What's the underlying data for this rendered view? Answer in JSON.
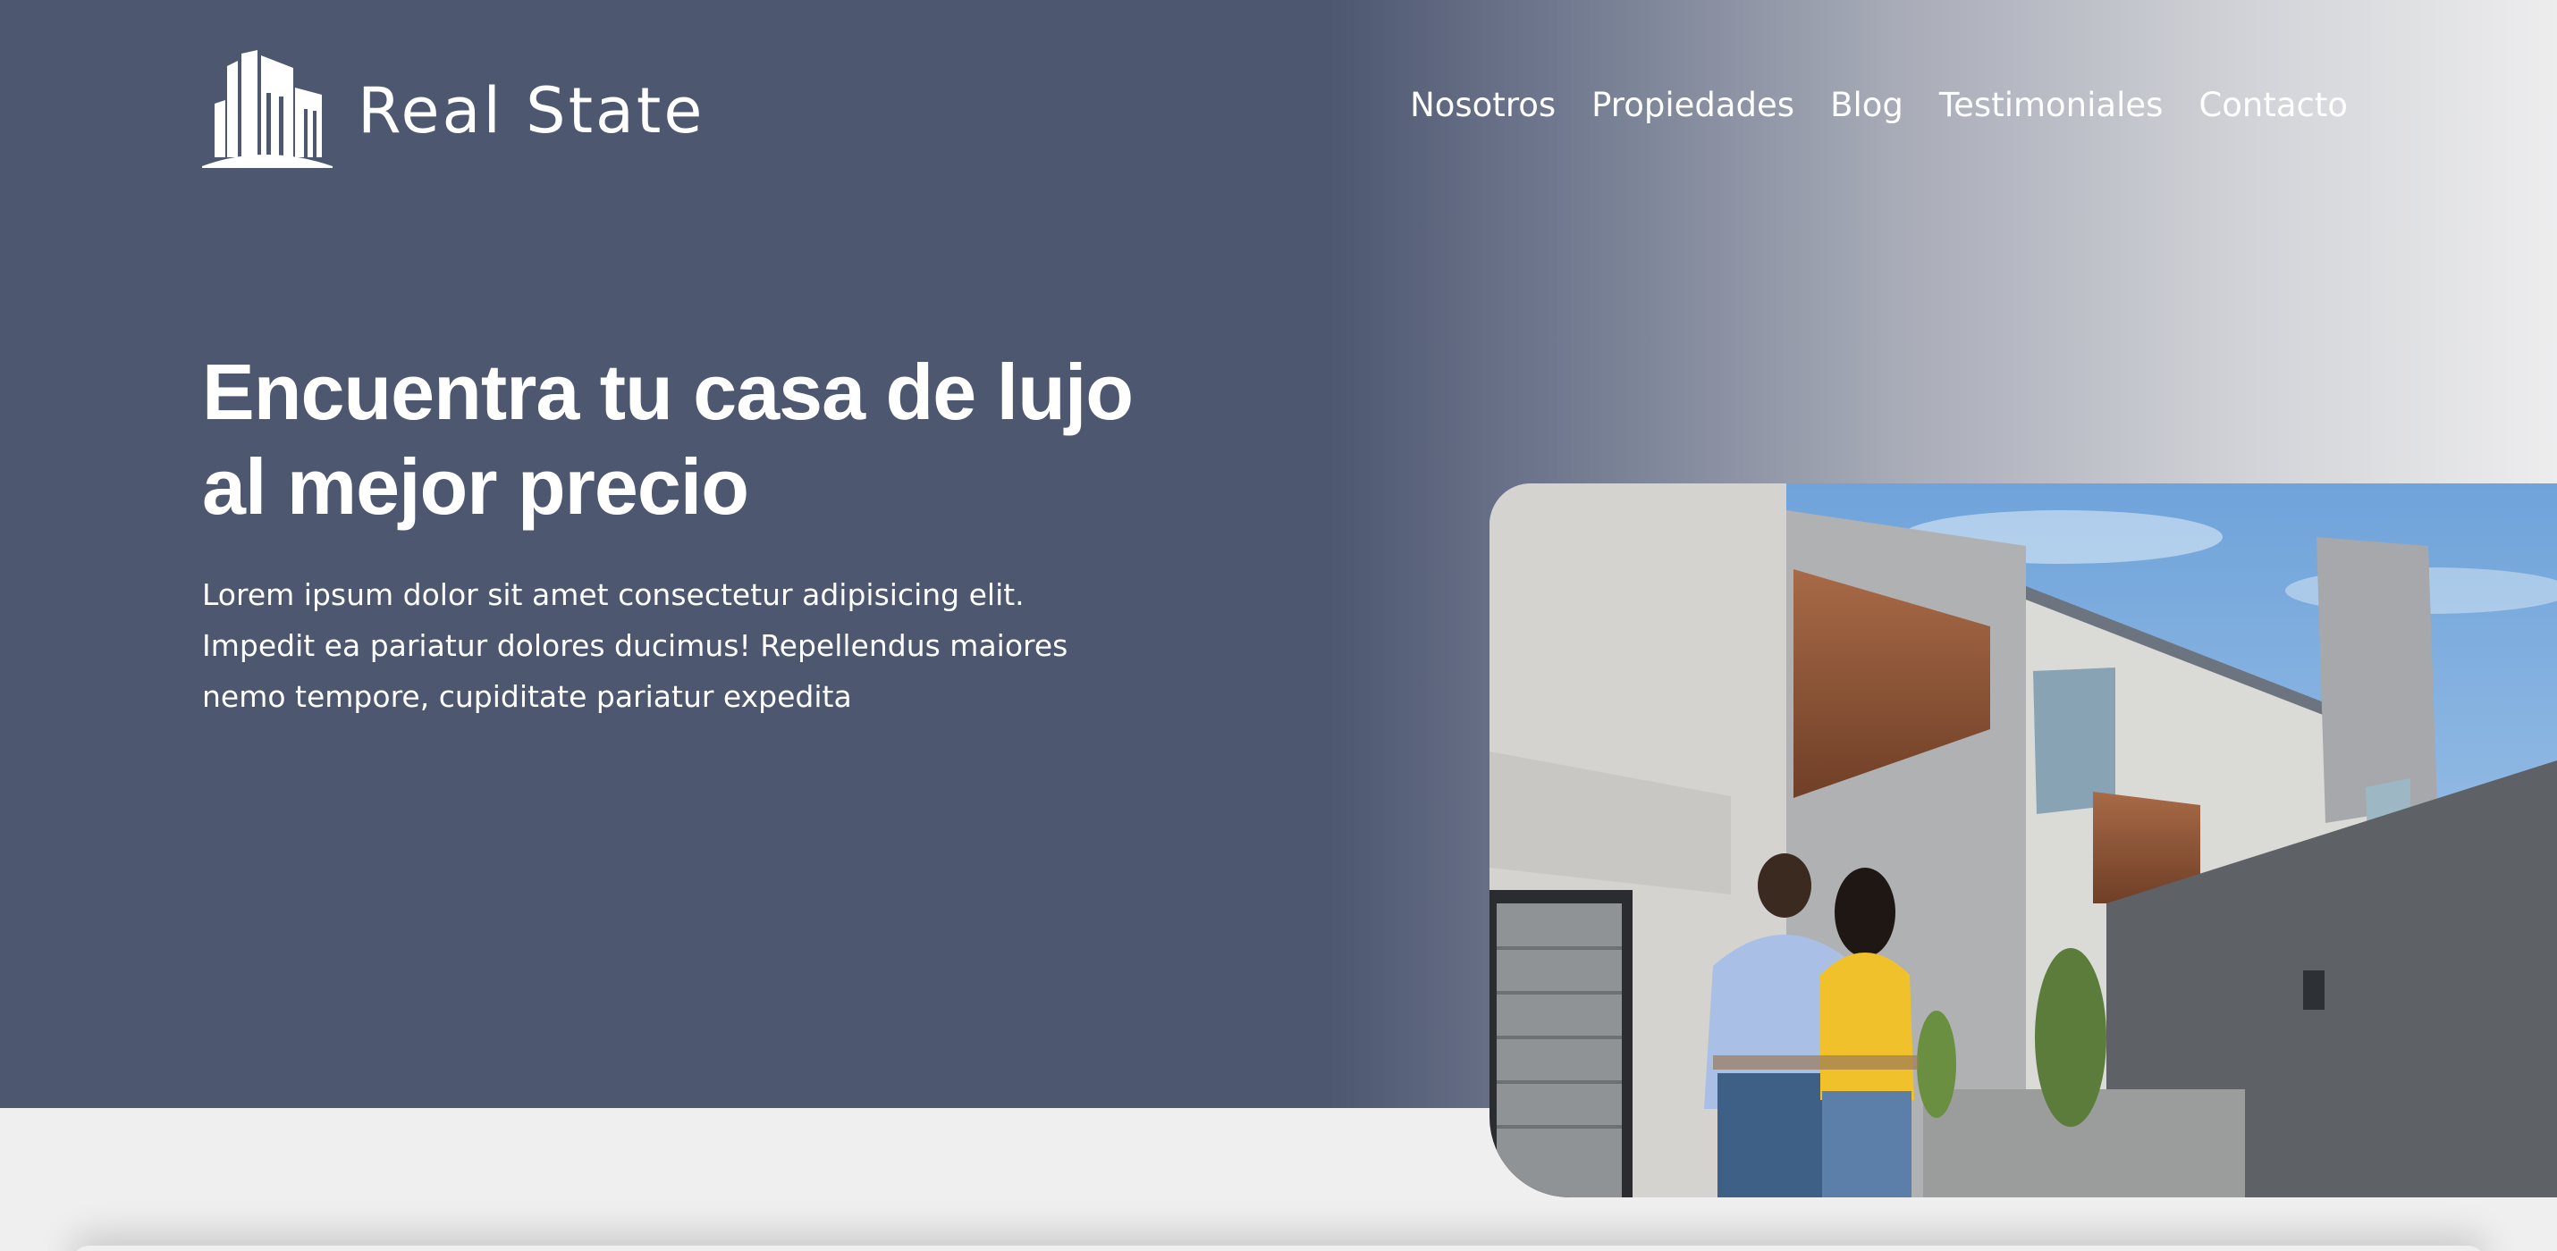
{
  "brand": {
    "name": "Real State",
    "logo_icon": "buildings-icon"
  },
  "nav": {
    "items": [
      {
        "label": "Nosotros"
      },
      {
        "label": "Propiedades"
      },
      {
        "label": "Blog"
      },
      {
        "label": "Testimoniales"
      },
      {
        "label": "Contacto"
      }
    ]
  },
  "hero": {
    "title_line1": "Encuentra tu casa de lujo",
    "title_line2": "al mejor precio",
    "description": "Lorem ipsum dolor sit amet consectetur adipisicing elit. Impedit ea pariatur dolores ducimus! Repellendus maiores nemo tempore, cupiditate pariatur expedita",
    "image_alt": "couple-in-front-of-modern-house"
  },
  "colors": {
    "hero_bg": "#4d576f",
    "hero_fade": "#ededee",
    "page_bg": "#efefef",
    "text": "#ffffff"
  }
}
